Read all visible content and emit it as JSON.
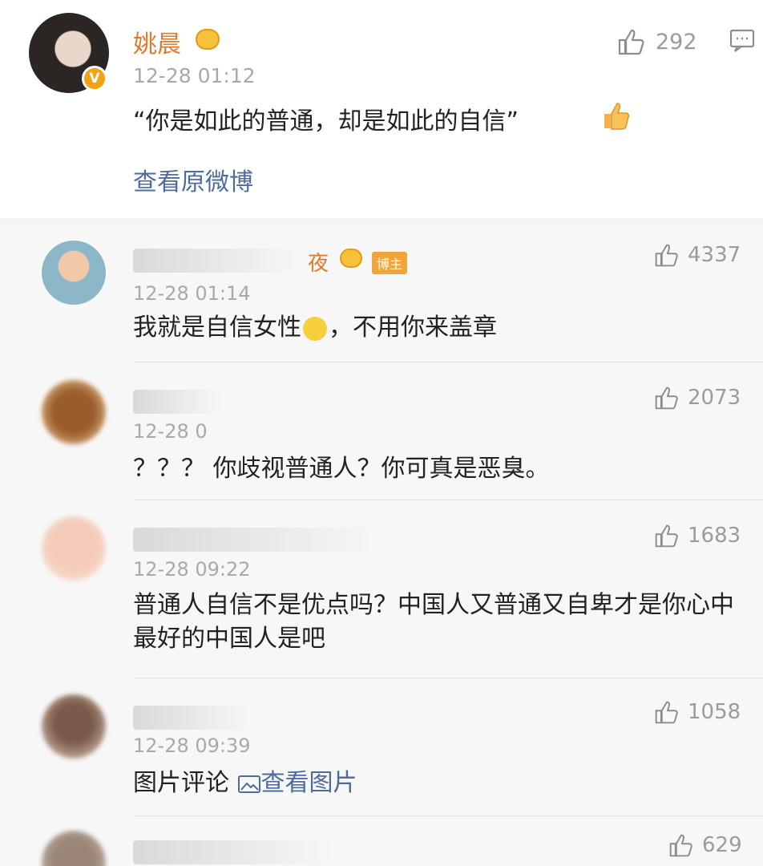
{
  "post": {
    "author": "姚晨",
    "time": "12-28 01:12",
    "text": "“你是如此的普通，却是如此的自信”",
    "emoji": "thumbs-up-emoji",
    "view_original": "查看原微博",
    "likes": "292",
    "verified_badge": "V",
    "colors": {
      "name": "#e07a2b",
      "link": "#4d6c9c",
      "meta": "#a9a9a9"
    }
  },
  "comments": [
    {
      "name_visible": "夜",
      "badge": "博主",
      "time": "12-28 01:14",
      "text_before": "我就是自信女性",
      "text_after": "，不用你来盖章",
      "likes": "4337"
    },
    {
      "time": "12-28 0",
      "text": "？？？ 你歧视普通人？你可真是恶臭。",
      "likes": "2073"
    },
    {
      "time": "12-28 09:22",
      "text": "普通人自信不是优点吗？中国人又普通又自卑才是你心中最好的中国人是吧",
      "likes": "1683"
    },
    {
      "time": "12-28 09:39",
      "text": "图片评论 ",
      "link": "查看图片",
      "likes": "1058"
    },
    {
      "likes": "629"
    }
  ]
}
